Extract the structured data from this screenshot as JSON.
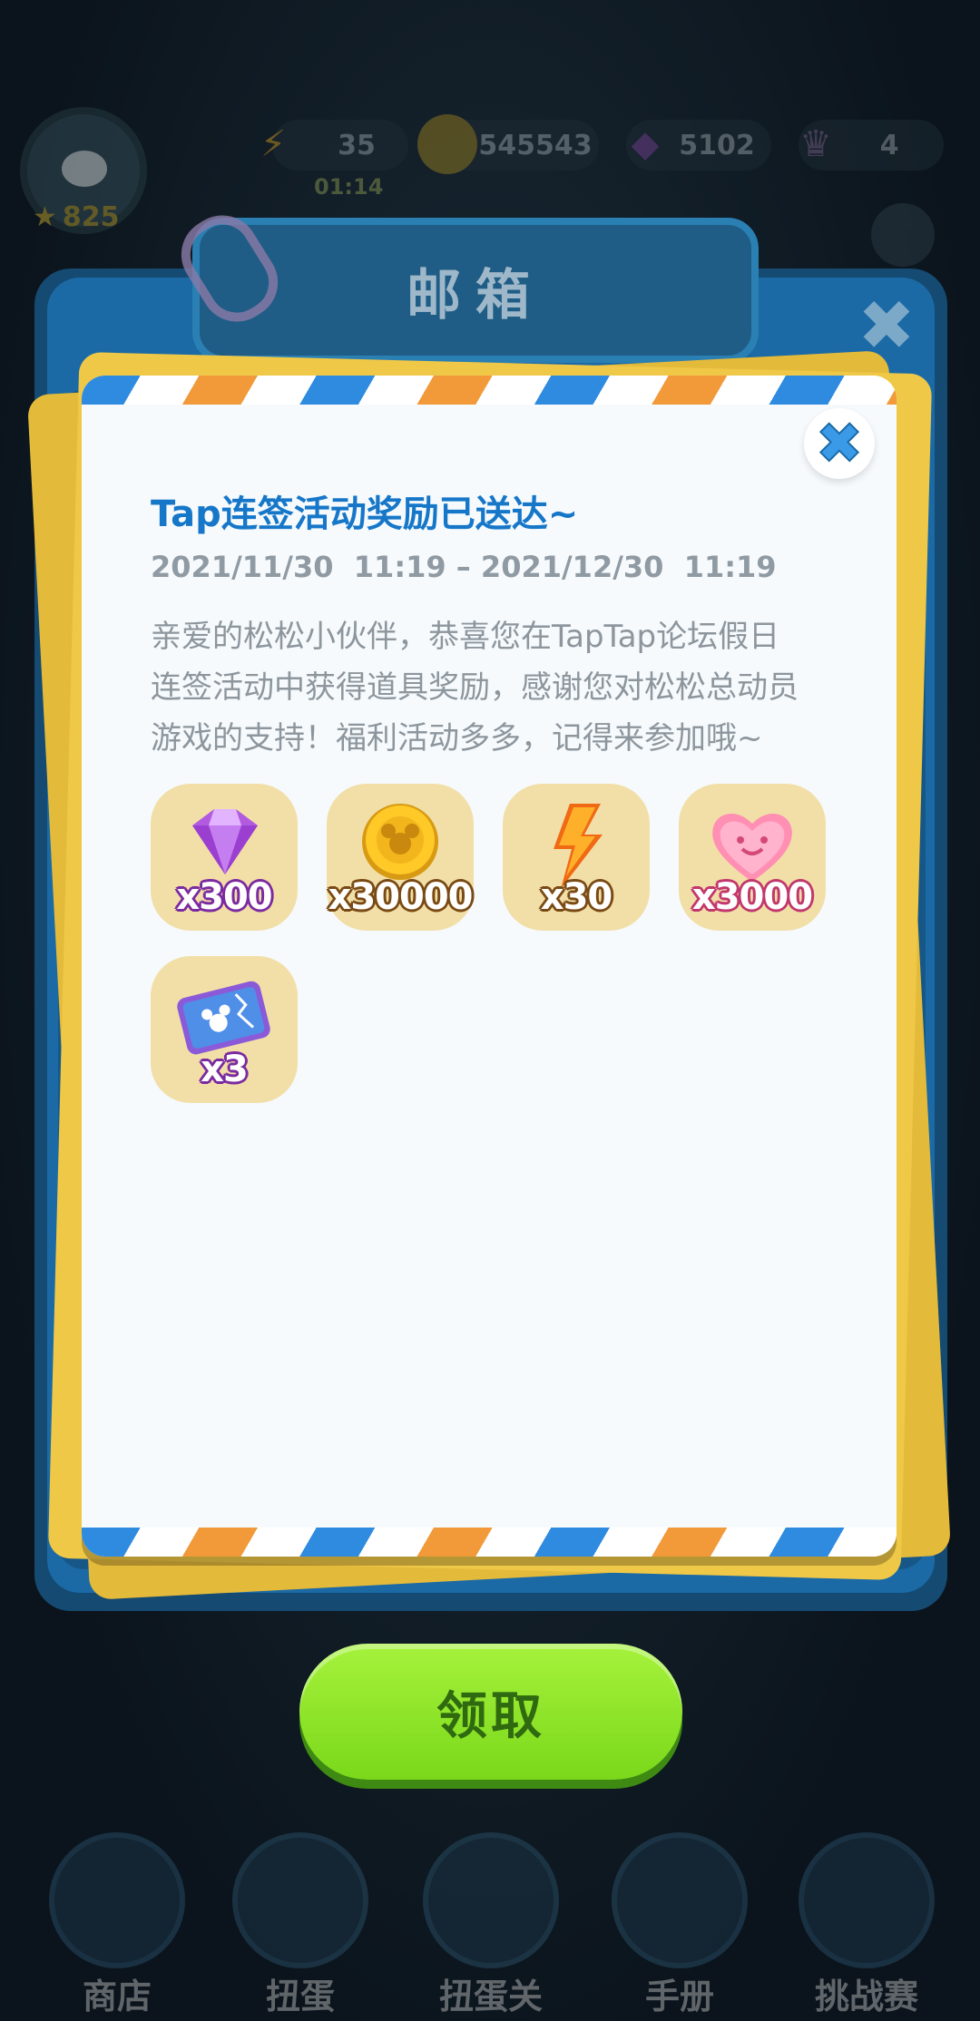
{
  "hud": {
    "energy": "35",
    "energy_timer": "01:14",
    "coins": "545543",
    "gems": "5102",
    "crowns": "4",
    "level": "825"
  },
  "mailbox": {
    "title": "邮箱"
  },
  "mail": {
    "title": "Tap连签活动奖励已送达~",
    "date_range": "2021/11/30  11:19 – 2021/12/30  11:19",
    "body_lines": [
      "亲爱的松松小伙伴，恭喜您在TapTap论坛假日",
      "连签活动中获得道具奖励，感谢您对松松总动员",
      "游戏的支持！福利活动多多，记得来参加哦~"
    ],
    "rewards": [
      {
        "icon": "gem-icon",
        "qty": "x300"
      },
      {
        "icon": "coin-icon",
        "qty": "x30000"
      },
      {
        "icon": "lightning-icon",
        "qty": "x30"
      },
      {
        "icon": "heart-icon",
        "qty": "x3000"
      },
      {
        "icon": "ticket-icon",
        "qty": "x3"
      }
    ]
  },
  "claim_button": "领取",
  "bottom_nav": [
    "商店",
    "扭蛋",
    "扭蛋关",
    "手册",
    "挑战赛"
  ],
  "colors": {
    "title_blue": "#1677c9",
    "claim_green": "#8ee12a",
    "frame_blue": "#1b6aa6"
  }
}
